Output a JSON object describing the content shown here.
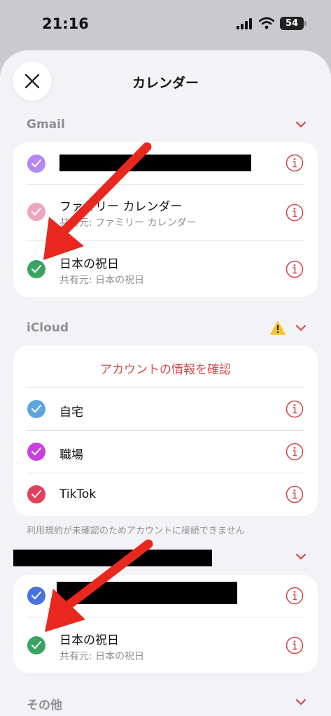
{
  "status": {
    "time": "21:16",
    "battery": "54"
  },
  "header": {
    "title": "カレンダー"
  },
  "gmail": {
    "label": "Gmail",
    "items": [
      {
        "name": "",
        "sub": "",
        "color": "#b388f5"
      },
      {
        "name": "ファミリー カレンダー",
        "sub": "共有元: ファミリー カレンダー",
        "color": "#eea4bf"
      },
      {
        "name": "日本の祝日",
        "sub": "共有元: 日本の祝日",
        "color": "#3aa363"
      }
    ]
  },
  "icloud": {
    "label": "iCloud",
    "confirm_link": "アカウントの情報を確認",
    "items": [
      {
        "name": "自宅",
        "color": "#5aa5e0"
      },
      {
        "name": "職場",
        "color": "#c93fe0"
      },
      {
        "name": "TikTok",
        "color": "#e2405a"
      }
    ],
    "note": "利用規約が未確認のためアカウントに接続できません"
  },
  "third": {
    "items": [
      {
        "name": "",
        "color": "#4a6fe0"
      },
      {
        "name": "日本の祝日",
        "sub": "共有元: 日本の祝日",
        "color": "#3aa363"
      }
    ]
  },
  "other": {
    "label": "その他"
  },
  "colors": {
    "accent": "#d44a4a",
    "arrow": "#e8281e"
  }
}
